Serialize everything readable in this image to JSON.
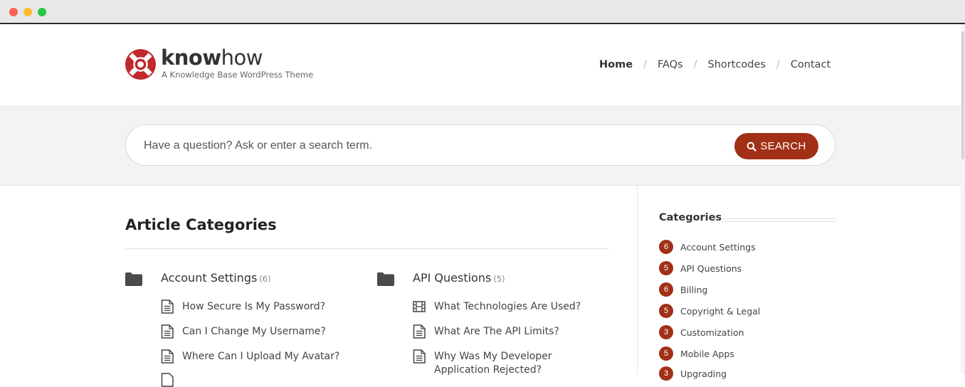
{
  "brand": {
    "name_bold": "know",
    "name_light": "how",
    "tagline": "A Knowledge Base WordPress Theme",
    "accent_color": "#a13016"
  },
  "nav": {
    "items": [
      {
        "label": "Home",
        "active": true
      },
      {
        "label": "FAQs"
      },
      {
        "label": "Shortcodes"
      },
      {
        "label": "Contact"
      }
    ],
    "separator": "/"
  },
  "search": {
    "placeholder": "Have a question? Ask or enter a search term.",
    "button_label": "SEARCH",
    "button_icon": "search-icon"
  },
  "main": {
    "title": "Article Categories",
    "categories": [
      {
        "title": "Account Settings",
        "count": "(6)",
        "icon": "folder-icon",
        "articles": [
          {
            "title": "How Secure Is My Password?",
            "icon": "document-icon"
          },
          {
            "title": "Can I Change My Username?",
            "icon": "document-icon"
          },
          {
            "title": "Where Can I Upload My Avatar?",
            "icon": "document-icon"
          }
        ]
      },
      {
        "title": "API Questions",
        "count": "(5)",
        "icon": "folder-icon",
        "articles": [
          {
            "title": "What Technologies Are Used?",
            "icon": "film-icon"
          },
          {
            "title": "What Are The API Limits?",
            "icon": "document-icon"
          },
          {
            "title": "Why Was My Developer",
            "title_line2": "Application Rejected?",
            "icon": "document-icon"
          }
        ]
      }
    ]
  },
  "sidebar": {
    "title": "Categories",
    "items": [
      {
        "count": "6",
        "label": "Account Settings"
      },
      {
        "count": "5",
        "label": "API Questions"
      },
      {
        "count": "6",
        "label": "Billing"
      },
      {
        "count": "5",
        "label": "Copyright & Legal"
      },
      {
        "count": "3",
        "label": "Customization"
      },
      {
        "count": "5",
        "label": "Mobile Apps"
      },
      {
        "count": "3",
        "label": "Upgrading"
      }
    ]
  }
}
